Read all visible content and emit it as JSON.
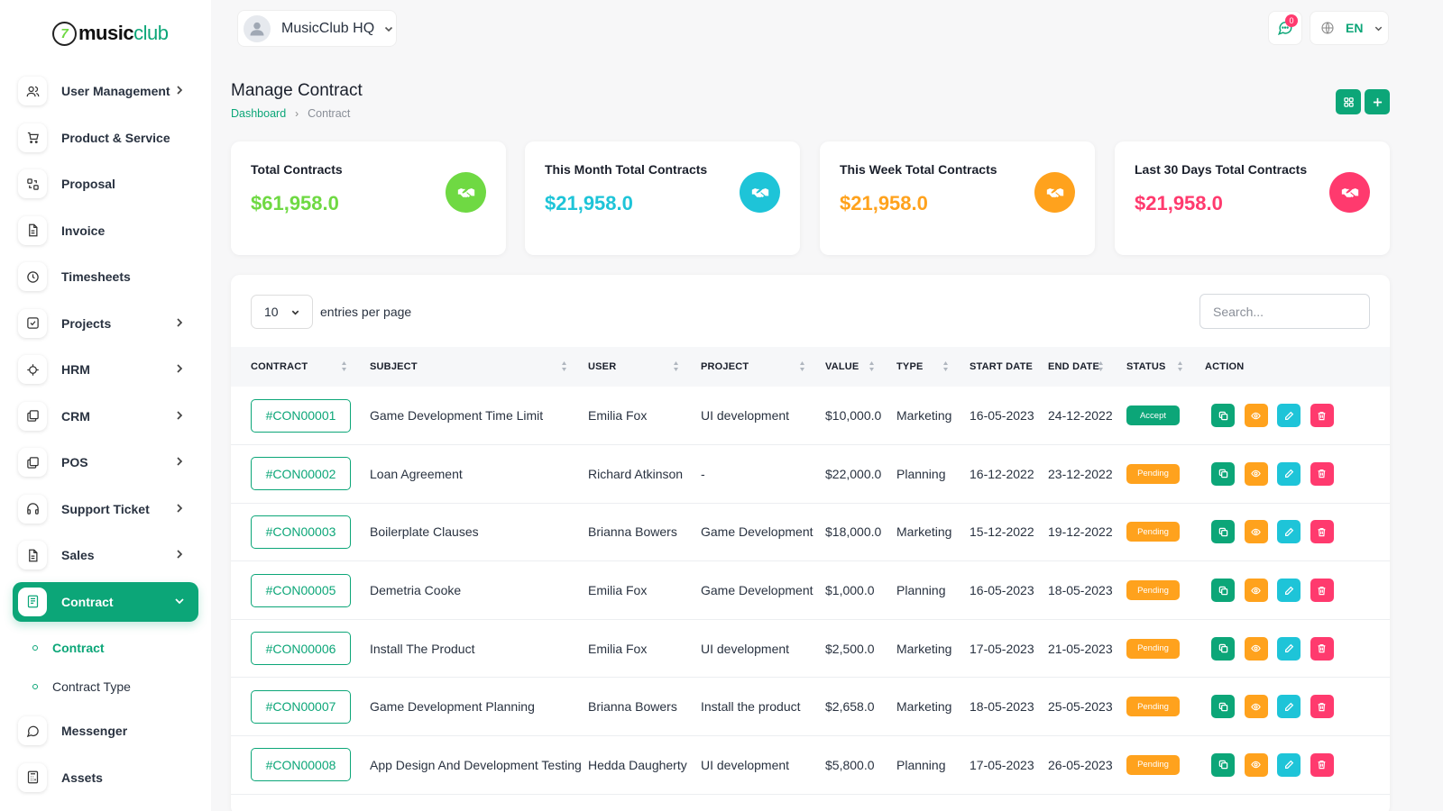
{
  "brand": {
    "logo_mark": "7",
    "name_main": "music",
    "name_accent": "club"
  },
  "workspace": {
    "name": "MusicClub HQ"
  },
  "header": {
    "messages_count": "0",
    "language": "EN"
  },
  "sidebar": {
    "items": [
      {
        "label": "User Management",
        "icon": "users-icon",
        "chevron": true
      },
      {
        "label": "Product & Service",
        "icon": "cart-icon",
        "chevron": false
      },
      {
        "label": "Proposal",
        "icon": "exchange-icon",
        "chevron": false
      },
      {
        "label": "Invoice",
        "icon": "file-icon",
        "chevron": false
      },
      {
        "label": "Timesheets",
        "icon": "clock-icon",
        "chevron": false
      },
      {
        "label": "Projects",
        "icon": "checkbox-icon",
        "chevron": true
      },
      {
        "label": "HRM",
        "icon": "target-icon",
        "chevron": true
      },
      {
        "label": "CRM",
        "icon": "layers-icon",
        "chevron": true
      },
      {
        "label": "POS",
        "icon": "layers-icon",
        "chevron": true
      },
      {
        "label": "Support Ticket",
        "icon": "headphones-icon",
        "chevron": true
      },
      {
        "label": "Sales",
        "icon": "file-icon",
        "chevron": true
      },
      {
        "label": "Contract",
        "icon": "contract-icon",
        "chevron": true,
        "active": true
      },
      {
        "label": "Messenger",
        "icon": "chat-icon",
        "chevron": false
      },
      {
        "label": "Assets",
        "icon": "calculator-icon",
        "chevron": false
      }
    ],
    "contract_sub": [
      {
        "label": "Contract",
        "active": true
      },
      {
        "label": "Contract Type",
        "active": false
      }
    ]
  },
  "page": {
    "title": "Manage Contract",
    "breadcrumb": {
      "home": "Dashboard",
      "current": "Contract"
    }
  },
  "stats": [
    {
      "title": "Total Contracts",
      "value": "$61,958.0",
      "color": "#6fd943",
      "icon": "handshake-icon"
    },
    {
      "title": "This Month Total Contracts",
      "value": "$21,958.0",
      "color": "#1ec4d8",
      "icon": "handshake-icon"
    },
    {
      "title": "This Week Total Contracts",
      "value": "$21,958.0",
      "color": "#ffa21d",
      "icon": "handshake-icon"
    },
    {
      "title": "Last 30 Days Total Contracts",
      "value": "$21,958.0",
      "color": "#ff3a6e",
      "icon": "handshake-icon"
    }
  ],
  "table": {
    "per_page": "10",
    "per_page_label": "entries per page",
    "search_placeholder": "Search...",
    "columns": [
      "CONTRACT",
      "SUBJECT",
      "USER",
      "PROJECT",
      "VALUE",
      "TYPE",
      "START DATE",
      "END DATE",
      "STATUS",
      "ACTION"
    ],
    "rows": [
      {
        "id": "#CON00001",
        "subject": "Game Development Time Limit",
        "user": "Emilia Fox",
        "project": "UI development",
        "value": "$10,000.0",
        "type": "Marketing",
        "start": "16-05-2023",
        "end": "24-12-2022",
        "status": "Accept"
      },
      {
        "id": "#CON00002",
        "subject": "Loan Agreement",
        "user": "Richard Atkinson",
        "project": "-",
        "value": "$22,000.0",
        "type": "Planning",
        "start": "16-12-2022",
        "end": "23-12-2022",
        "status": "Pending"
      },
      {
        "id": "#CON00003",
        "subject": "Boilerplate Clauses",
        "user": "Brianna Bowers",
        "project": "Game Development",
        "value": "$18,000.0",
        "type": "Marketing",
        "start": "15-12-2022",
        "end": "19-12-2022",
        "status": "Pending"
      },
      {
        "id": "#CON00005",
        "subject": "Demetria Cooke",
        "user": "Emilia Fox",
        "project": "Game Development",
        "value": "$1,000.0",
        "type": "Planning",
        "start": "16-05-2023",
        "end": "18-05-2023",
        "status": "Pending"
      },
      {
        "id": "#CON00006",
        "subject": "Install The Product",
        "user": "Emilia Fox",
        "project": "UI development",
        "value": "$2,500.0",
        "type": "Marketing",
        "start": "17-05-2023",
        "end": "21-05-2023",
        "status": "Pending"
      },
      {
        "id": "#CON00007",
        "subject": "Game Development Planning",
        "user": "Brianna Bowers",
        "project": "Install the product",
        "value": "$2,658.0",
        "type": "Marketing",
        "start": "18-05-2023",
        "end": "25-05-2023",
        "status": "Pending"
      },
      {
        "id": "#CON00008",
        "subject": "App Design And Development Testing",
        "user": "Hedda Daugherty",
        "project": "UI development",
        "value": "$5,800.0",
        "type": "Planning",
        "start": "17-05-2023",
        "end": "26-05-2023",
        "status": "Pending"
      }
    ]
  },
  "colors": {
    "accent": "#0ca678",
    "accept": "#0ca678",
    "pending": "#ffa21d",
    "copy": "#0ca678",
    "view": "#ffa21d",
    "edit": "#1ec4d8",
    "delete": "#ff3a6e"
  }
}
